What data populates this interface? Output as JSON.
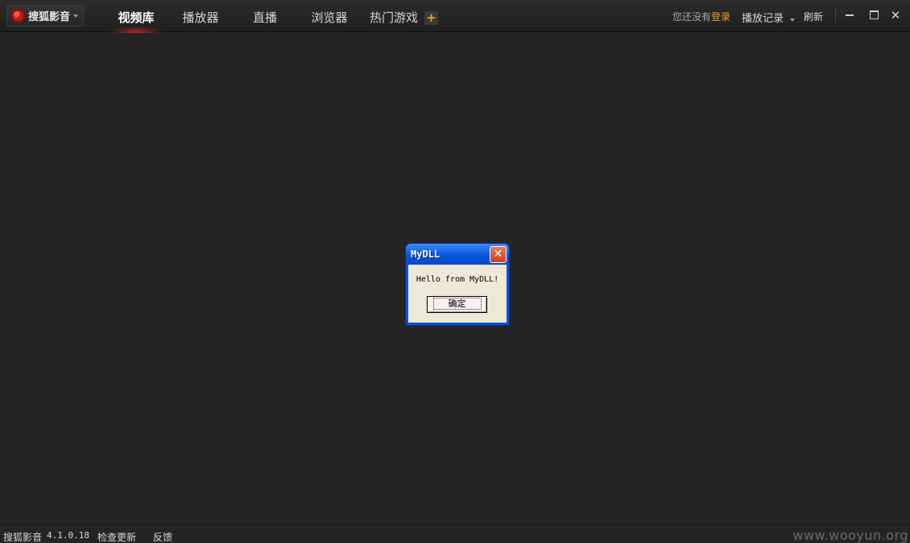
{
  "app": {
    "brand_label": "搜狐影音"
  },
  "tabs": [
    {
      "label": "视频库",
      "active": true
    },
    {
      "label": "播放器",
      "active": false
    },
    {
      "label": "直播",
      "active": false
    },
    {
      "label": "浏览器",
      "active": false
    },
    {
      "label": "热门游戏",
      "active": false
    }
  ],
  "header": {
    "add_label": "+",
    "login_prompt": "您还没有",
    "login_link": "登录",
    "history_label": "播放记录",
    "refresh_label": "刷新",
    "minimize_icon": "minimize-icon",
    "maximize_icon": "maximize-icon",
    "close_label": "✕"
  },
  "dialog": {
    "title": "MyDLL",
    "message": "Hello from MyDLL!",
    "ok_label": "确定",
    "close_label": "✕"
  },
  "status": {
    "app_name": "搜狐影音",
    "version": "4.1.0.18",
    "check_update": "检查更新",
    "feedback": "反馈",
    "watermark": "www.wooyun.org"
  },
  "colors": {
    "accent": "#f39c2a",
    "background": "#242424",
    "tab_glow": "#e62828"
  }
}
